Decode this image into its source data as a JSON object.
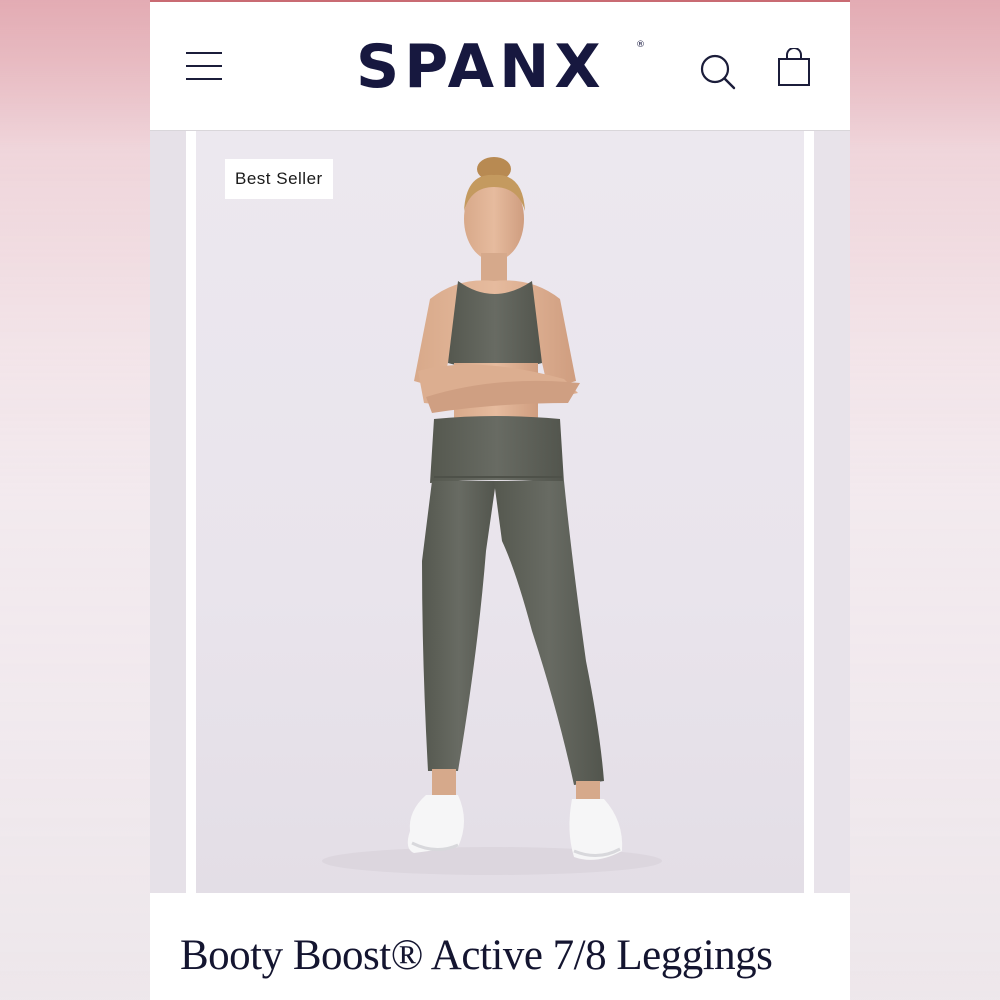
{
  "header": {
    "brand": "SPANX",
    "brand_mark": "®",
    "icons": [
      "menu-icon",
      "search-icon",
      "shopping-bag-icon"
    ]
  },
  "product": {
    "badge": "Best Seller",
    "title": "Booty Boost® Active 7/8 Leggings"
  },
  "colors": {
    "brand_navy": "#17183f",
    "garment": "#5f625b",
    "image_background": "#ebe7ee"
  }
}
